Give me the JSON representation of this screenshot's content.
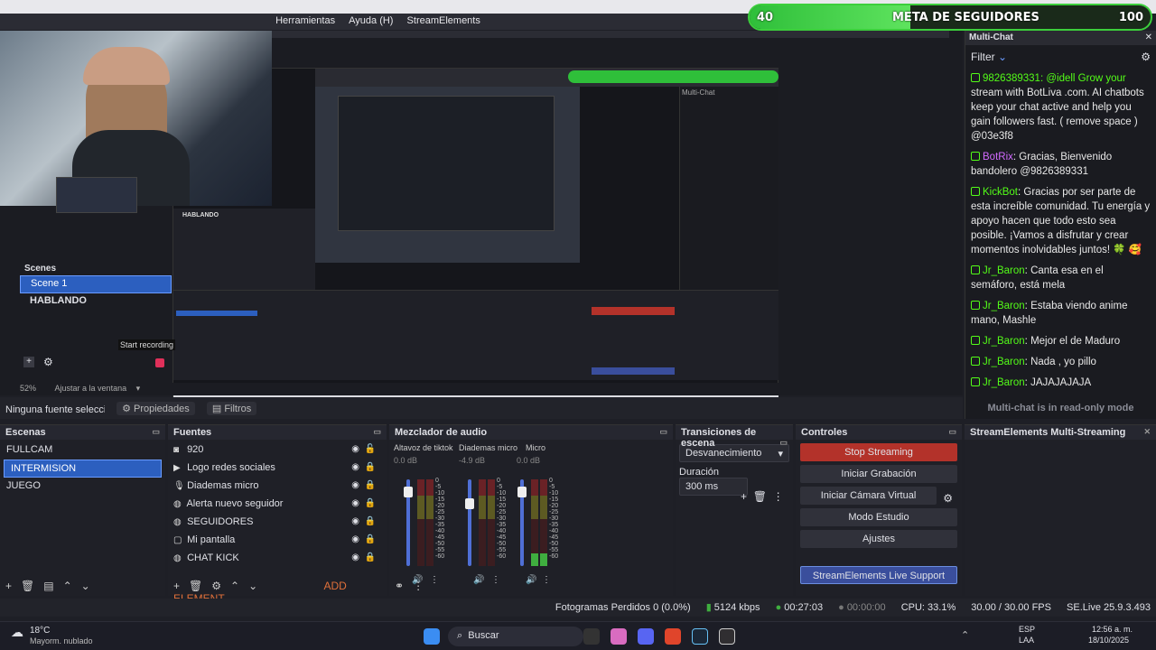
{
  "menu": {
    "items": [
      "Herramientas",
      "Ayuda (H)",
      "StreamElements"
    ]
  },
  "goal": {
    "current": "40",
    "label": "META DE SEGUIDORES",
    "target": "100",
    "progress_fraction": 0.4
  },
  "preview": {
    "scenes_label": "Scenes",
    "scenes": [
      "Scene 1",
      "HABLANDO"
    ],
    "start_recording": "Start recording",
    "zoom": "52%",
    "fit": "Ajustar a la ventana"
  },
  "multichat": {
    "title": "Multi-Chat",
    "filter": "Filter",
    "messages": [
      {
        "user": "",
        "text": "stream with BotLiva .com. AI chatbots keep your chat active and help you gain followers fast. ( remove space ) @03e3f8",
        "prefix": "9826389331: @idell Grow your"
      },
      {
        "user": "BotRix",
        "text": "Gracias, Bienvenido bandolero @9826389331"
      },
      {
        "user": "KickBot",
        "text": "Gracias por ser parte de esta increíble comunidad. Tu energía y apoyo hacen que todo esto sea posible. ¡Vamos a disfrutar y crear momentos inolvidables juntos! 🍀 🥰"
      },
      {
        "user": "Jr_Baron",
        "text": "Canta esa en el semáforo, está mela"
      },
      {
        "user": "Jr_Baron",
        "text": "Estaba viendo anime mano, Mashle"
      },
      {
        "user": "Jr_Baron",
        "text": "Mejor el de Maduro"
      },
      {
        "user": "Jr_Baron",
        "text": "Nada , yo pillo"
      },
      {
        "user": "Jr_Baron",
        "text": "JAJAJAJAJA"
      }
    ],
    "readonly": "Multi-chat is in read-only mode"
  },
  "context": {
    "text": "Ninguna fuente seleccionada",
    "properties": "Propiedades",
    "filters": "Filtros"
  },
  "docks": {
    "scenes": {
      "title": "Escenas",
      "items": [
        "FULLCAM",
        "INTERMISION",
        "JUEGO"
      ],
      "selected": 1
    },
    "sources": {
      "title": "Fuentes",
      "items": [
        "920",
        "Logo redes sociales",
        "Diademas micro",
        "Alerta nuevo seguidor",
        "SEGUIDORES",
        "Mi pantalla",
        "CHAT KICK"
      ],
      "add_element": "ADD ELEMENT"
    },
    "mixer": {
      "title": "Mezclador de audio",
      "channels": [
        {
          "name": "Altavoz de tiktok",
          "db": "0.0 dB",
          "level": 0.0,
          "volume": 0.9
        },
        {
          "name": "Diademas micro",
          "db": "-4.9 dB",
          "level": 0.0,
          "volume": 0.75
        },
        {
          "name": "Micro",
          "db": "0.0 dB",
          "level": 0.15,
          "volume": 0.9
        }
      ],
      "scale": [
        "0",
        "-5",
        "-10",
        "-15",
        "-20",
        "-25",
        "-30",
        "-35",
        "-40",
        "-45",
        "-50",
        "-55",
        "-60"
      ]
    },
    "transitions": {
      "title": "Transiciones de escena",
      "type": "Desvanecimiento",
      "duration_label": "Duración",
      "duration": "300 ms"
    },
    "controls": {
      "title": "Controles",
      "stop": "Stop Streaming",
      "record": "Iniciar Grabación",
      "vcam": "Iniciar Cámara Virtual",
      "studio": "Modo Estudio",
      "settings": "Ajustes",
      "support": "StreamElements Live Support"
    },
    "multistream": {
      "title": "StreamElements Multi-Streaming"
    }
  },
  "status": {
    "dropped": "Fotogramas Perdidos 0 (0.0%)",
    "kbps": "5124 kbps",
    "live_time": "00:27:03",
    "rec_time": "00:00:00",
    "cpu": "CPU: 33.1%",
    "fps": "30.00 / 30.00 FPS",
    "version": "SE.Live 25.9.3.493"
  },
  "taskbar": {
    "temp": "18°C",
    "weather": "Mayorm. nublado",
    "search": "Buscar",
    "lang": "ESP",
    "region": "LAA",
    "time": "12:56 a. m.",
    "date": "18/10/2025"
  },
  "colors": {
    "accent": "#2c5fbf",
    "stop_red": "#b3322a",
    "kick_green": "#53fc18",
    "goal_green": "#3ccf3c"
  }
}
